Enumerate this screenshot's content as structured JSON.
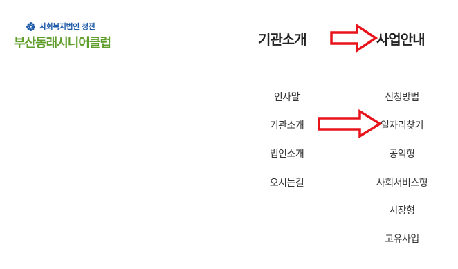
{
  "logo": {
    "subtitle": "사회복지법인 청전",
    "title": "부산동래시니어클럽",
    "icon": "gear-flower-icon"
  },
  "nav": {
    "items": [
      {
        "label": "기관소개"
      },
      {
        "label": "사업안내"
      }
    ]
  },
  "dropdown": {
    "columns": [
      {
        "items": [
          "인사말",
          "기관소개",
          "법인소개",
          "오시는길"
        ]
      },
      {
        "items": [
          "신청방법",
          "일자리찾기",
          "공익형",
          "사회서비스형",
          "시장형",
          "고유사업"
        ]
      }
    ]
  },
  "annotations": {
    "arrow_color": "#e8141c",
    "arrow_icon": "red-right-arrow-icon"
  },
  "colors": {
    "logo_blue": "#1e5aa8",
    "logo_green": "#5f9e2b"
  }
}
